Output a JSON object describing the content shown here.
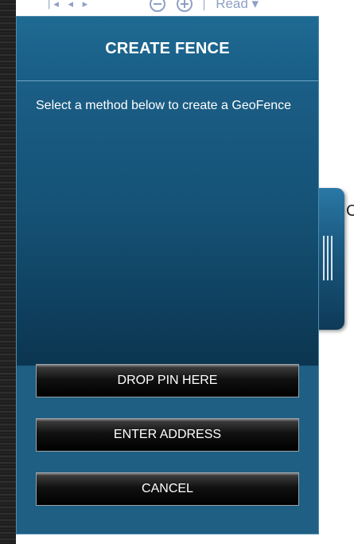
{
  "background": {
    "toolbar": {
      "nav_text": "|◂ ◂ ▸",
      "read_label": "Read ▾"
    },
    "partial_letter": "C"
  },
  "panel": {
    "title": "CREATE FENCE",
    "description": "Select a method below to create a GeoFence",
    "buttons": {
      "drop_pin": "DROP PIN HERE",
      "enter_address": "ENTER ADDRESS",
      "cancel": "CANCEL"
    }
  },
  "colors": {
    "panel_bg": "#1e5f83",
    "header_divider": "#6fa7c8",
    "button_bg": "#000000",
    "text": "#ffffff"
  },
  "icons": {
    "zoom_out": "zoom-out-icon",
    "zoom_in": "zoom-in-icon",
    "grip": "drag-handle-icon"
  }
}
